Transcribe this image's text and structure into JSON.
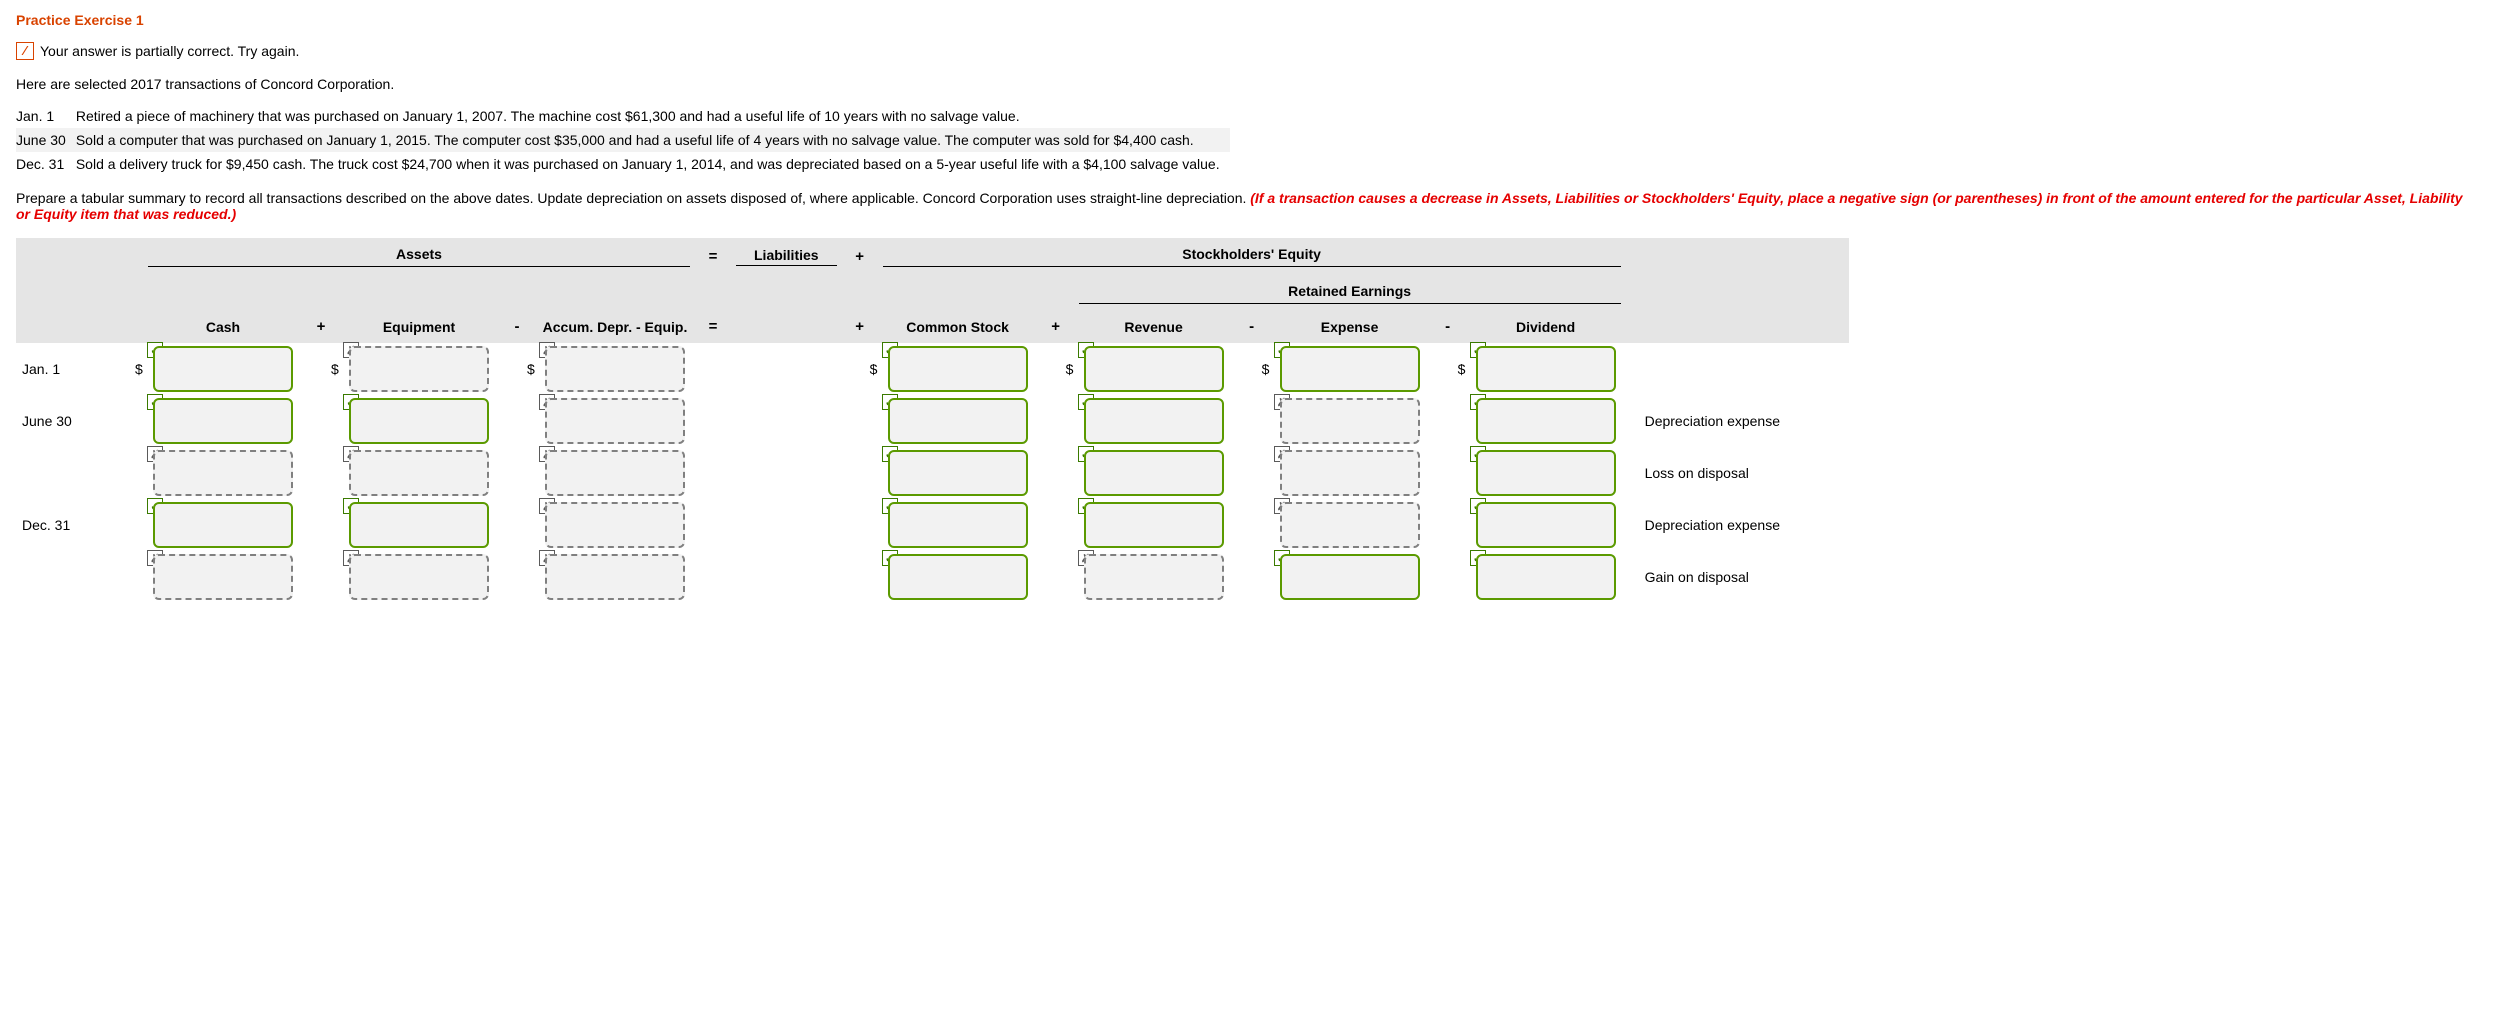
{
  "title": "Practice Exercise 1",
  "feedback": {
    "icon_glyph": "⁄",
    "text": "Your answer is partially correct.  Try again."
  },
  "intro": "Here are selected 2017 transactions of Concord Corporation.",
  "transactions": [
    {
      "date": "Jan. 1",
      "text": "Retired a piece of machinery that was purchased on January 1, 2007. The machine cost $61,300 and had a useful life of 10 years with no salvage value."
    },
    {
      "date": "June 30",
      "text": "Sold a computer that was purchased on January 1, 2015. The computer cost $35,000 and had a useful life of 4 years with no salvage value. The computer was sold for $4,400 cash."
    },
    {
      "date": "Dec. 31",
      "text": "Sold a delivery truck for $9,450 cash. The truck cost $24,700 when it was purchased on January 1, 2014, and was depreciated based on a 5-year useful life with a $4,100 salvage value."
    }
  ],
  "prepare": "Prepare a tabular summary to record all transactions described on the above dates. Update depreciation on assets disposed of, where applicable. Concord Corporation uses straight-line depreciation.",
  "warning": "(If a transaction causes a decrease in Assets, Liabilities or Stockholders' Equity, place a negative sign (or parentheses) in front of the amount entered for the particular Asset, Liability or Equity item that was reduced.)",
  "headers": {
    "assets": "Assets",
    "liabilities": "Liabilities",
    "se": "Stockholders' Equity",
    "re": "Retained Earnings",
    "cash": "Cash",
    "equipment": "Equipment",
    "ad": "Accum. Depr. - Equip.",
    "cs": "Common Stock",
    "rev": "Revenue",
    "exp": "Expense",
    "div": "Dividend"
  },
  "ops": {
    "plus": "+",
    "minus": "-",
    "eq": "="
  },
  "row_labels": [
    "Jan. 1",
    "June 30",
    "",
    "Dec. 31",
    ""
  ],
  "row_notes": [
    "",
    "Depreciation expense",
    "Loss on disposal",
    "Depreciation expense",
    "Gain on disposal"
  ],
  "marks": {
    "ok": "✓",
    "bad": "✗",
    "dollar": "$"
  },
  "cells": [
    {
      "cash": {
        "s": "ok",
        "sign": true
      },
      "equip": {
        "s": "bad",
        "sign": true
      },
      "ad": {
        "s": "bad",
        "sign": true
      },
      "cs": {
        "s": "ok",
        "sign": true
      },
      "rev": {
        "s": "ok",
        "sign": true
      },
      "exp": {
        "s": "ok",
        "sign": true
      },
      "div": {
        "s": "ok",
        "sign": true
      }
    },
    {
      "cash": {
        "s": "ok"
      },
      "equip": {
        "s": "ok"
      },
      "ad": {
        "s": "bad"
      },
      "cs": {
        "s": "ok"
      },
      "rev": {
        "s": "ok"
      },
      "exp": {
        "s": "bad"
      },
      "div": {
        "s": "ok"
      }
    },
    {
      "cash": {
        "s": "bad"
      },
      "equip": {
        "s": "bad"
      },
      "ad": {
        "s": "bad"
      },
      "cs": {
        "s": "ok"
      },
      "rev": {
        "s": "ok"
      },
      "exp": {
        "s": "bad"
      },
      "div": {
        "s": "ok"
      }
    },
    {
      "cash": {
        "s": "ok"
      },
      "equip": {
        "s": "ok"
      },
      "ad": {
        "s": "bad"
      },
      "cs": {
        "s": "ok"
      },
      "rev": {
        "s": "ok"
      },
      "exp": {
        "s": "bad"
      },
      "div": {
        "s": "ok"
      }
    },
    {
      "cash": {
        "s": "bad"
      },
      "equip": {
        "s": "bad"
      },
      "ad": {
        "s": "bad"
      },
      "cs": {
        "s": "ok"
      },
      "rev": {
        "s": "bad"
      },
      "exp": {
        "s": "ok"
      },
      "div": {
        "s": "ok"
      }
    }
  ]
}
